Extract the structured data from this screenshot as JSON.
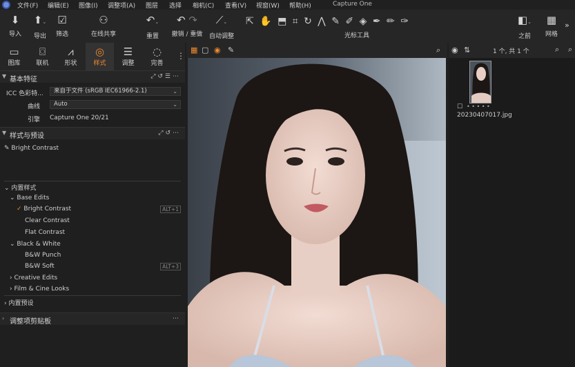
{
  "window_title": "Capture One",
  "menu": [
    "文件(F)",
    "编辑(E)",
    "图像(I)",
    "调整项(A)",
    "图层",
    "选择",
    "相机(C)",
    "查看(V)",
    "视窗(W)",
    "帮助(H)"
  ],
  "toolbar": {
    "import": "导入",
    "export": "导出",
    "filter": "筛选",
    "share": "在线共享",
    "reset": "重置",
    "undo_redo": "撤销 / 重做",
    "auto_adjust": "自动调整",
    "cursor_tools": "光标工具",
    "before": "之前",
    "grid": "网格"
  },
  "tabs": [
    {
      "label": "图库",
      "icon": "library-icon"
    },
    {
      "label": "联机",
      "icon": "camera-icon"
    },
    {
      "label": "形状",
      "icon": "shape-icon"
    },
    {
      "label": "样式",
      "icon": "style-icon"
    },
    {
      "label": "调整",
      "icon": "adjust-icon"
    },
    {
      "label": "完善",
      "icon": "refine-icon"
    }
  ],
  "basic": {
    "title": "基本特征",
    "icc_label": "ICC 色彩特...",
    "icc_value": "来自于文件 (sRGB IEC61966-2.1)",
    "curve_label": "曲线",
    "curve_value": "Auto",
    "engine_label": "引擎",
    "engine_value": "Capture One 20/21"
  },
  "styles": {
    "title": "样式与预设",
    "applied": "Bright Contrast",
    "builtin_styles": "内置样式",
    "base_edits": "Base Edits",
    "base_items": [
      "Bright Contrast",
      "Clear Contrast",
      "Flat Contrast"
    ],
    "bright_shortcut": "ALT+1",
    "bw": "Black & White",
    "bw_items": [
      "B&W Punch",
      "B&W Soft"
    ],
    "bw_soft_shortcut": "ALT+3",
    "creative": "Creative Edits",
    "film": "Film & Cine Looks",
    "builtin_presets": "内置预设",
    "clipboard": "调整项剪贴板"
  },
  "browser": {
    "count": "1 个, 共 1 个",
    "filename": "20230407017.jpg",
    "rating_dots": "• • • • •"
  },
  "colors": {
    "accent": "#f08a2c",
    "panel": "#262626",
    "bg": "#1f1f1f"
  }
}
